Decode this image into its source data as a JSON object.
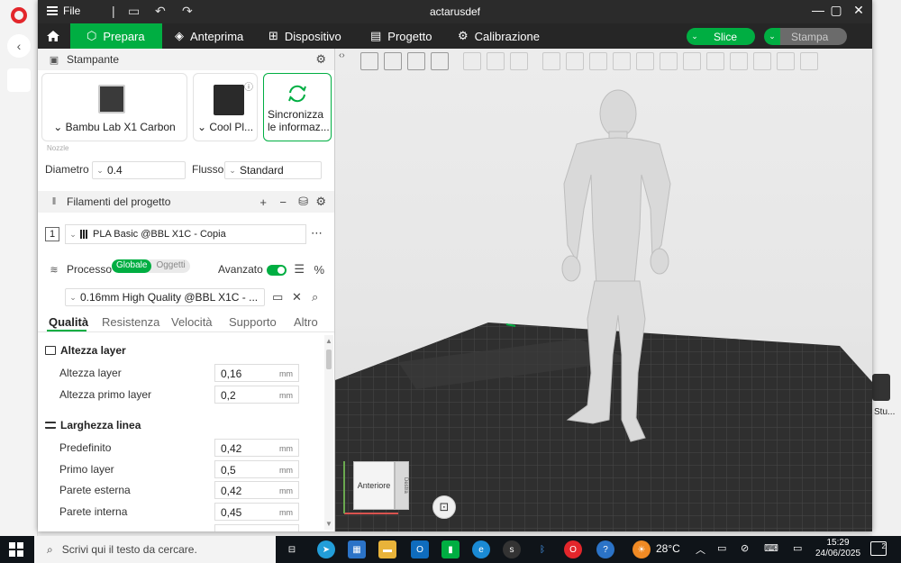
{
  "window": {
    "title": "actarusdef",
    "menu_label": "File"
  },
  "nav": {
    "tabs": [
      {
        "label": "Prepara",
        "active": true
      },
      {
        "label": "Anteprima",
        "active": false
      },
      {
        "label": "Dispositivo",
        "active": false
      },
      {
        "label": "Progetto",
        "active": false
      },
      {
        "label": "Calibrazione",
        "active": false
      }
    ],
    "slice_label": "Slice",
    "print_label": "Stampa"
  },
  "printer": {
    "section_title": "Stampante",
    "printer_name": "Bambu Lab X1 Carbon",
    "plate_name": "Cool Pl...",
    "sync_label_line1": "Sincronizza",
    "sync_label_line2": "le informaz...",
    "nozzle_caption": "Nozzle",
    "diameter_label": "Diametro",
    "diameter_value": "0.4",
    "flow_label": "Flusso",
    "flow_value": "Standard"
  },
  "filaments": {
    "section_title": "Filamenti del progetto",
    "items": [
      {
        "index": "1",
        "name": "PLA Basic @BBL X1C - Copia"
      }
    ]
  },
  "process": {
    "section_title": "Processo",
    "scope_global": "Globale",
    "scope_objects": "Oggetti",
    "advanced_label": "Avanzato",
    "preset": "0.16mm High Quality @BBL X1C - ...",
    "tabs": [
      "Qualità",
      "Resistenza",
      "Velocità",
      "Supporto",
      "Altro"
    ],
    "active_tab": "Qualità"
  },
  "params": {
    "layer_group": "Altezza layer",
    "layer_height_label": "Altezza layer",
    "layer_height_value": "0,16",
    "first_layer_label": "Altezza primo layer",
    "first_layer_value": "0,2",
    "width_group": "Larghezza linea",
    "default_label": "Predefinito",
    "default_value": "0,42",
    "first_width_label": "Primo layer",
    "first_width_value": "0,5",
    "outer_label": "Parete esterna",
    "outer_value": "0,42",
    "inner_label": "Parete interna",
    "inner_value": "0,45",
    "unit": "mm"
  },
  "viewport": {
    "cube_front": "Anteriore",
    "cube_right": "Destra"
  },
  "background": {
    "right_app_label": "Stu..."
  },
  "taskbar": {
    "search_placeholder": "Scrivi qui il testo da cercare.",
    "temperature": "28°C",
    "time": "15:29",
    "date": "24/06/2025",
    "notifications": "2"
  },
  "colors": {
    "accent": "#00ae42",
    "titlebar": "#2b2b2b",
    "navbar": "#262626"
  }
}
